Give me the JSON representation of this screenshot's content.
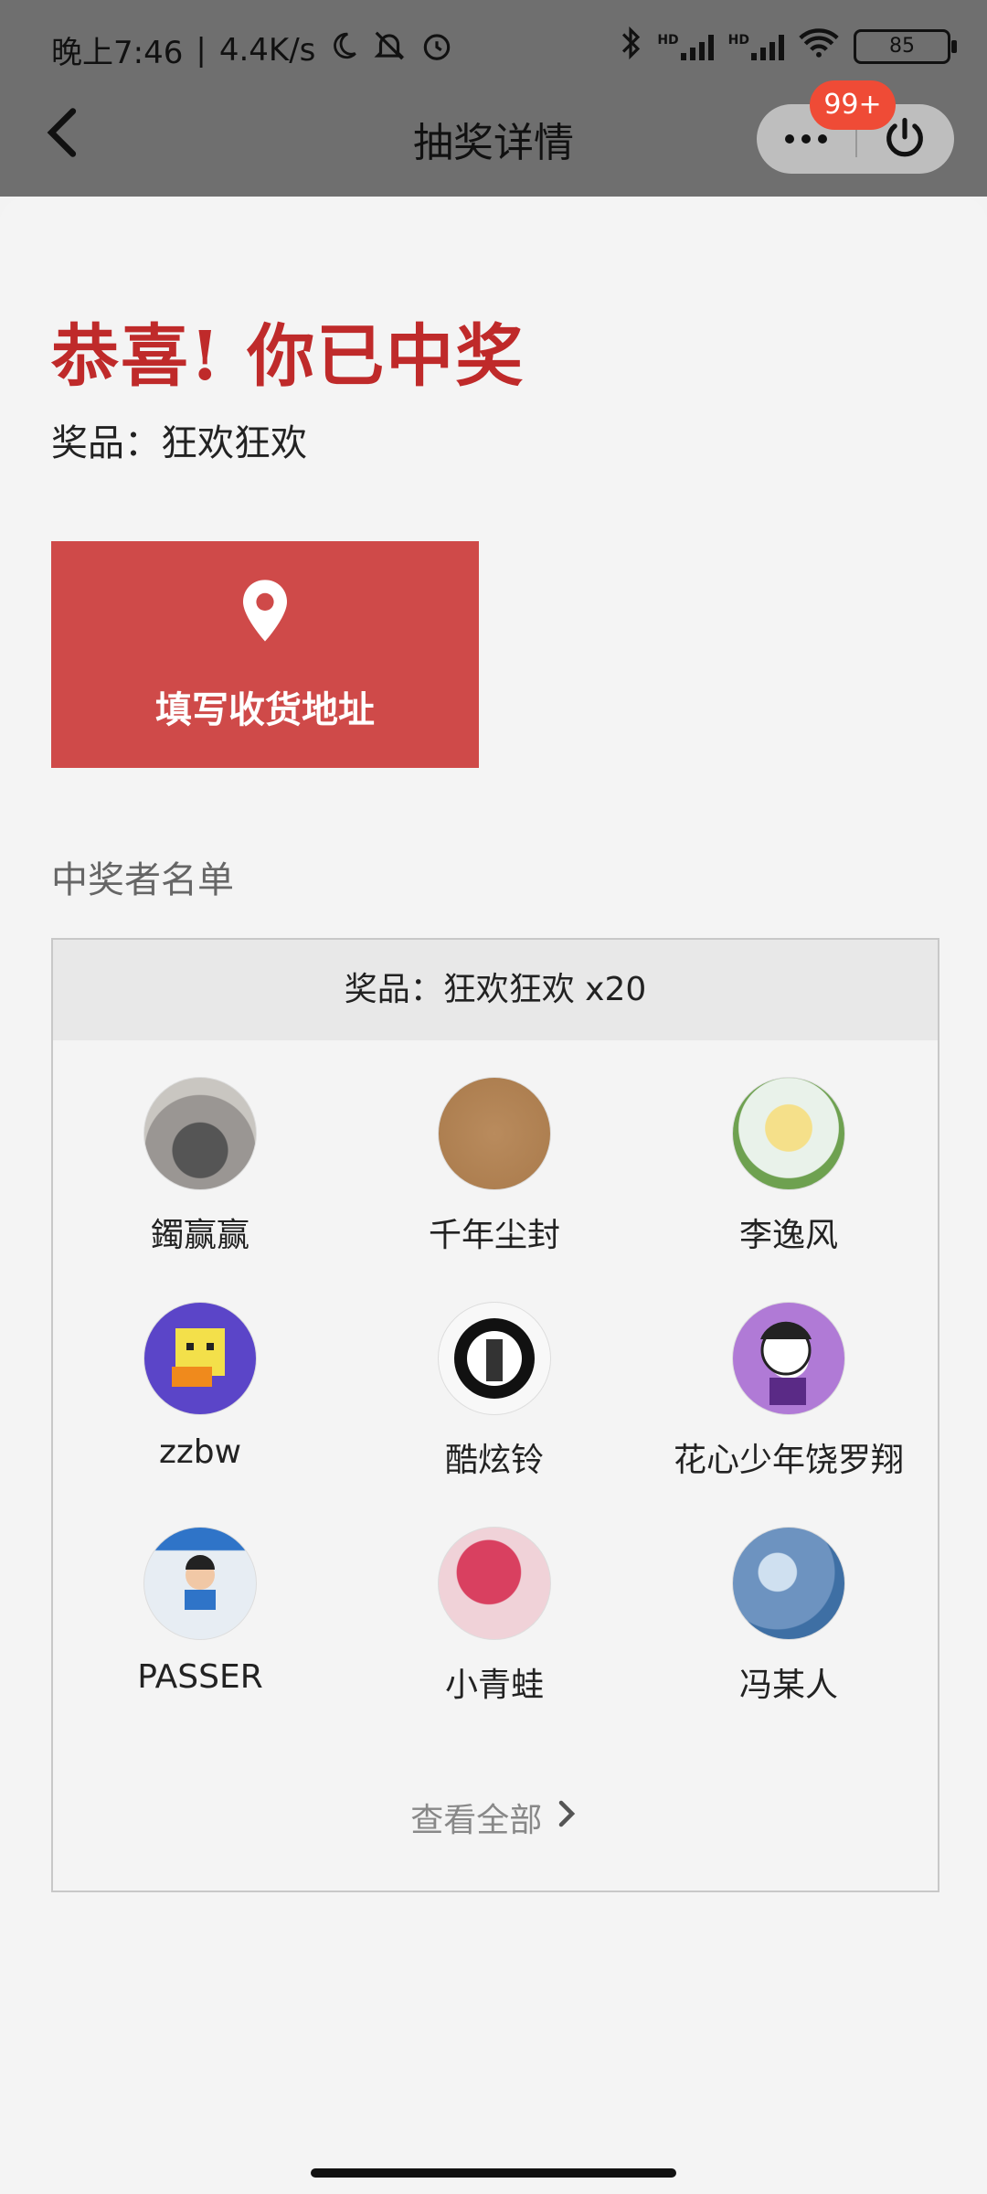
{
  "status_bar": {
    "time": "晚上7:46",
    "speed": "4.4K/s",
    "battery": "85",
    "net1": "HD",
    "net2": "HD"
  },
  "nav": {
    "title": "抽奖详情",
    "badge": "99+"
  },
  "result": {
    "headline": "恭喜! 你已中奖",
    "prize_line": "奖品：狂欢狂欢"
  },
  "address_button": {
    "label": "填写收货地址"
  },
  "winners": {
    "section_title": "中奖者名单",
    "table_header": "奖品：狂欢狂欢 x20",
    "users": [
      {
        "name": "鐲赢赢"
      },
      {
        "name": "千年尘封"
      },
      {
        "name": "李逸风"
      },
      {
        "name": "zzbw"
      },
      {
        "name": "酷炫铃"
      },
      {
        "name": "花心少年饶罗翔"
      },
      {
        "name": "PASSER"
      },
      {
        "name": "小青蛙"
      },
      {
        "name": "冯某人"
      }
    ],
    "view_all": "查看全部"
  },
  "colors": {
    "accent_red": "#bf2a2a",
    "button_red": "#cf4a49",
    "badge_red": "#ef4b36"
  },
  "icons": [
    "moon-icon",
    "mute-bell-icon",
    "alarm-icon",
    "bluetooth-icon",
    "signal-icon",
    "wifi-icon",
    "battery-icon",
    "back-icon",
    "more-icon",
    "power-icon",
    "location-pin-icon",
    "chevron-right-icon"
  ]
}
